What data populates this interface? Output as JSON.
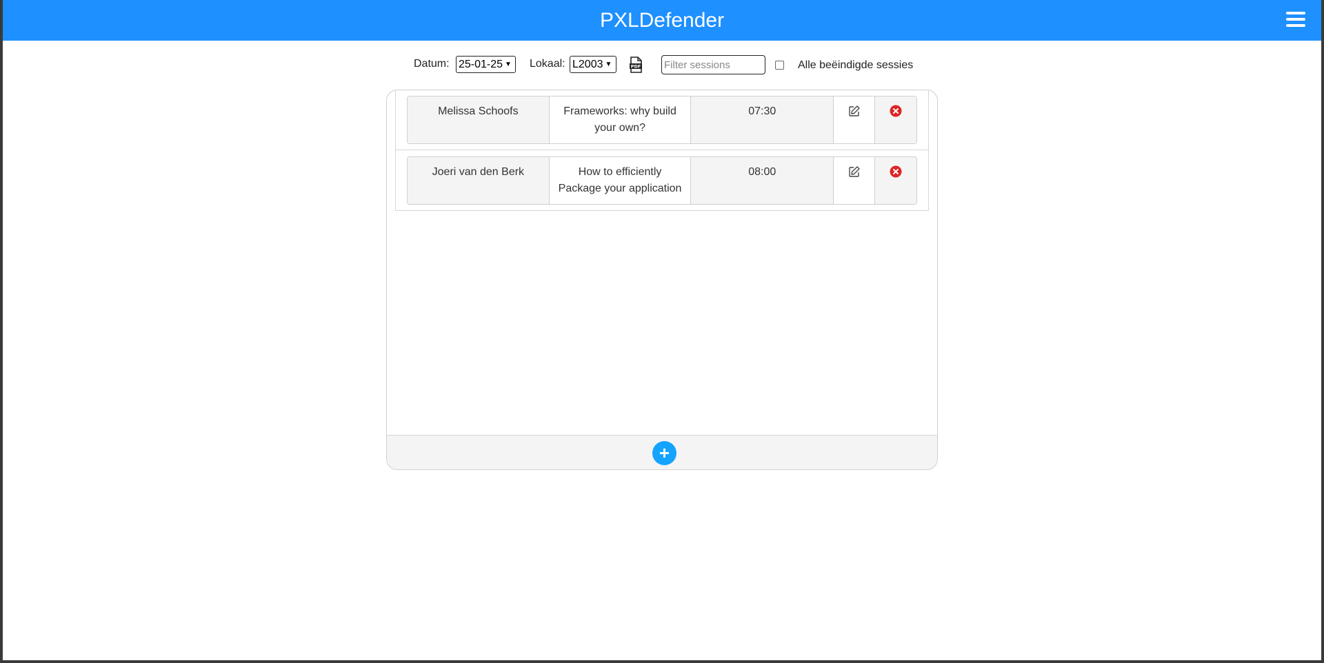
{
  "header": {
    "title": "PXLDefender",
    "menu_icon": "hamburger-menu-icon"
  },
  "toolbar": {
    "date_label": "Datum:",
    "date_value": "25-01-25",
    "room_label": "Lokaal:",
    "room_value": "L2003",
    "pdf_icon": "pdf-file-icon",
    "filter_placeholder": "Filter sessions",
    "filter_value": "",
    "ended_checkbox_checked": false,
    "ended_label": "Alle beëindigde sessies"
  },
  "sessions": [
    {
      "speaker": "Melissa Schoofs",
      "title": "Frameworks: why build your own?",
      "time": "07:30",
      "edit_icon": "pencil-edit-icon",
      "delete_icon": "red-x-circle-icon"
    },
    {
      "speaker": "Joeri van den Berk",
      "title": "How to efficiently Package your application",
      "time": "08:00",
      "edit_icon": "pencil-edit-icon",
      "delete_icon": "red-x-circle-icon"
    }
  ],
  "footer": {
    "add_label": "+",
    "add_icon": "plus-circle-icon"
  },
  "colors": {
    "header_bg": "#1e90ff",
    "add_button": "#14a3ff",
    "delete_icon": "#e02424"
  }
}
